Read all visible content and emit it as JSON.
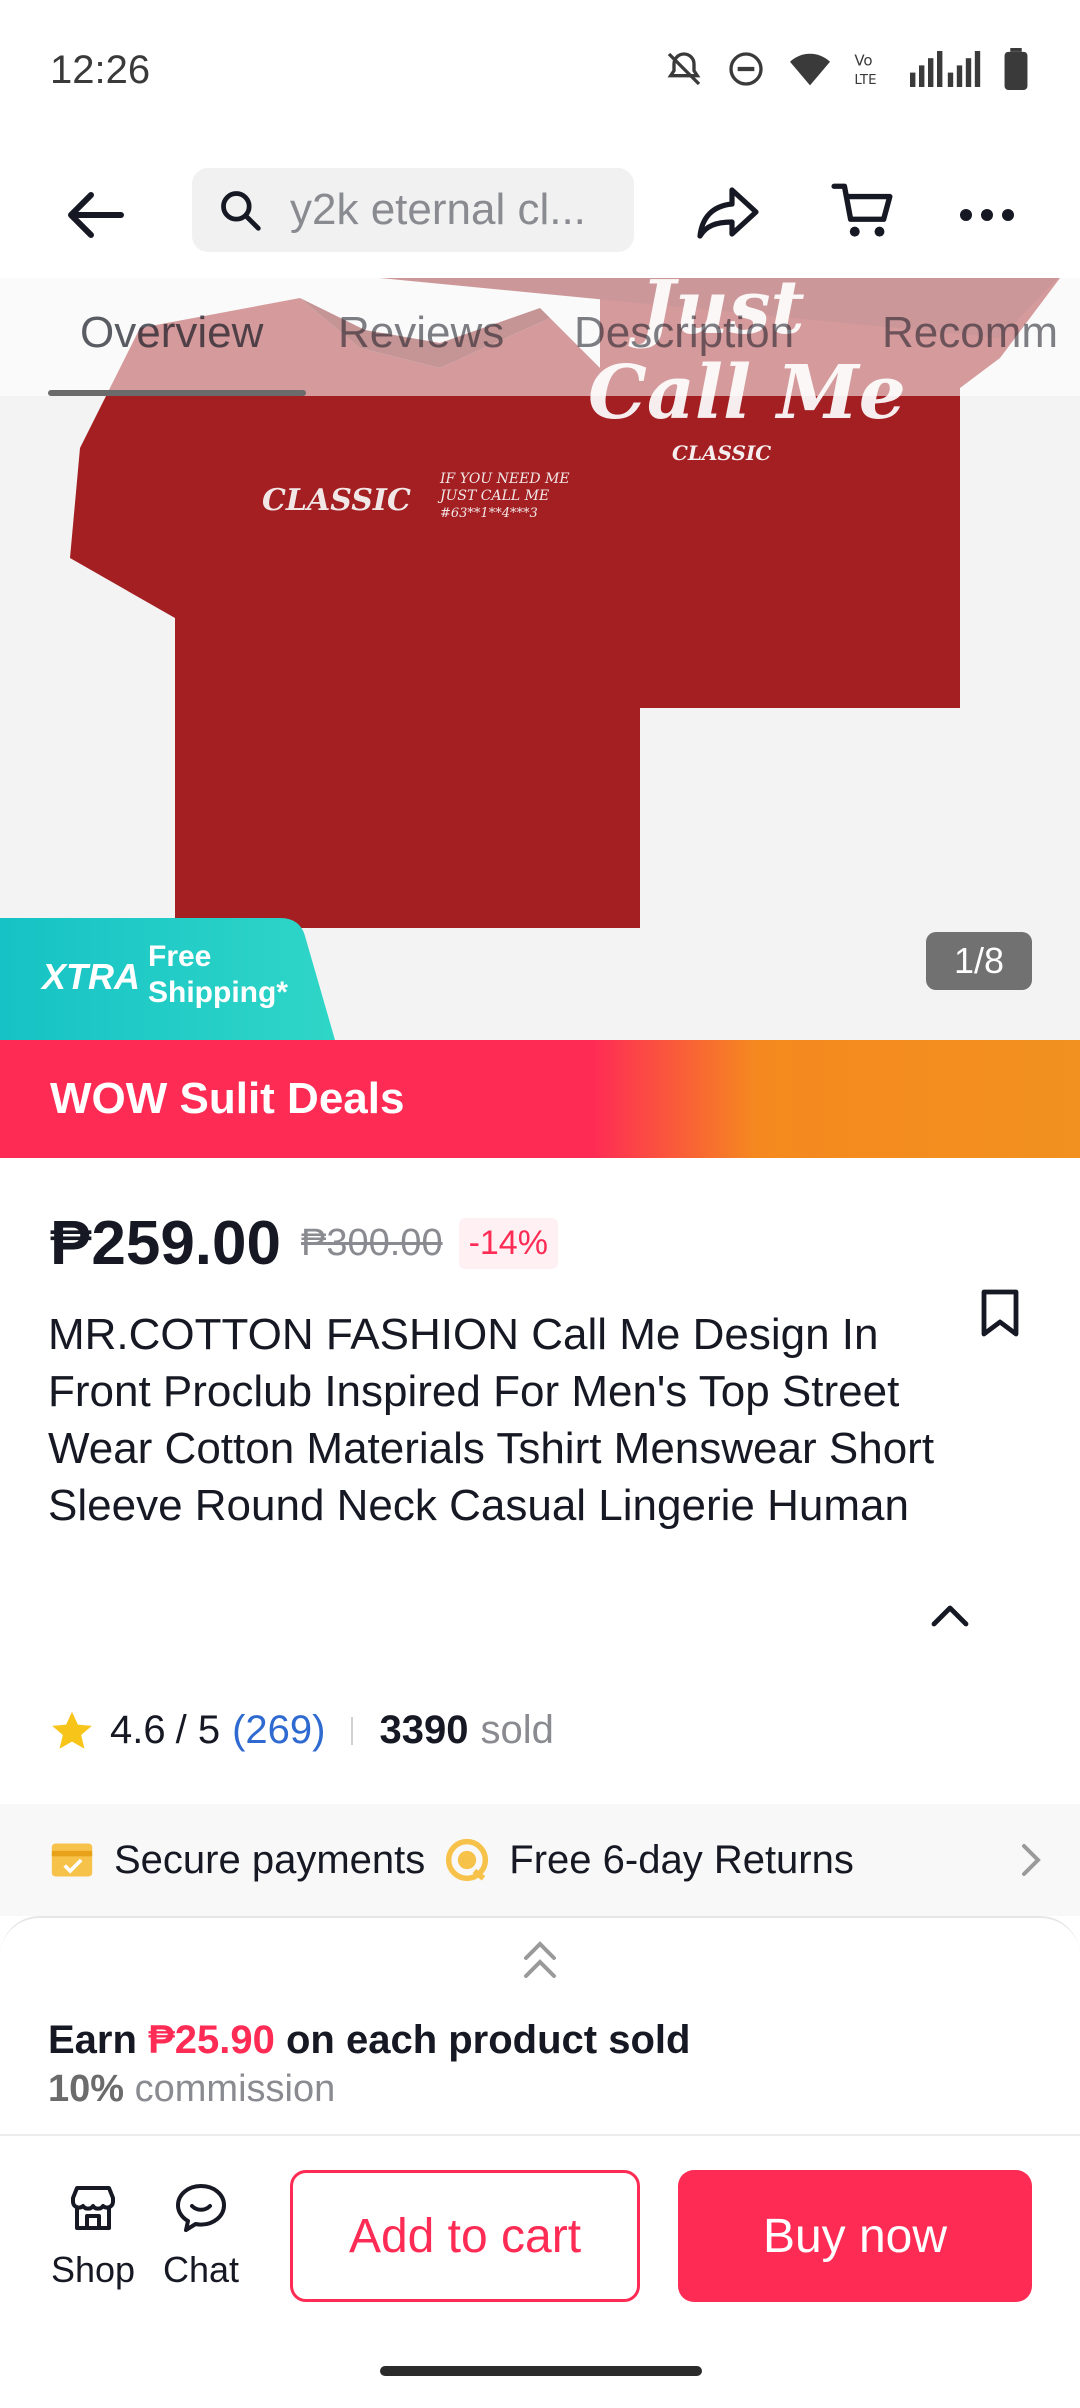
{
  "status_bar": {
    "time": "12:26"
  },
  "top_nav": {
    "search_text": "y2k eternal cl..."
  },
  "gallery": {
    "tabs": [
      "Overview",
      "Reviews",
      "Description",
      "Recomm"
    ],
    "active_tab": "Overview",
    "counter": "1/8",
    "image_text_front": "CLASSIC",
    "image_text_front_small": "IF YOU NEED ME JUST CALL ME #63**1**4***3",
    "image_text_back_line1": "Just",
    "image_text_back_line2": "Call Me",
    "image_text_back_small": "CLASSIC",
    "shirt_color": "#a31f22",
    "xtra_label": "XTRA",
    "xtra_line1": "Free",
    "xtra_line2": "Shipping*"
  },
  "promo": {
    "label": "WOW Sulit Deals"
  },
  "product": {
    "price": "₱259.00",
    "original_price": "₱300.00",
    "discount": "-14%",
    "title": "MR.COTTON FASHION Call Me Design In Front Proclub Inspired For Men's Top Street Wear Cotton Materials Tshirt Menswear Short Sleeve Round Neck Casual Lingerie Human"
  },
  "rating": {
    "score": "4.6",
    "max": "/ 5",
    "count": "(269)",
    "sold_count": "3390",
    "sold_label": "sold"
  },
  "services": {
    "secure": "Secure payments",
    "returns": "Free 6-day Returns"
  },
  "commission": {
    "earn_prefix": "Earn",
    "earn_amount": "₱25.90",
    "earn_suffix": "on each product sold",
    "percent": "10%",
    "percent_label": "commission"
  },
  "action_bar": {
    "shop": "Shop",
    "chat": "Chat",
    "add_to_cart": "Add to cart",
    "buy_now": "Buy now"
  },
  "colors": {
    "accent": "#fe2c55",
    "promo_end": "#f2911f",
    "link": "#2f6ad0",
    "xtra_teal": "#1fc6c4"
  }
}
